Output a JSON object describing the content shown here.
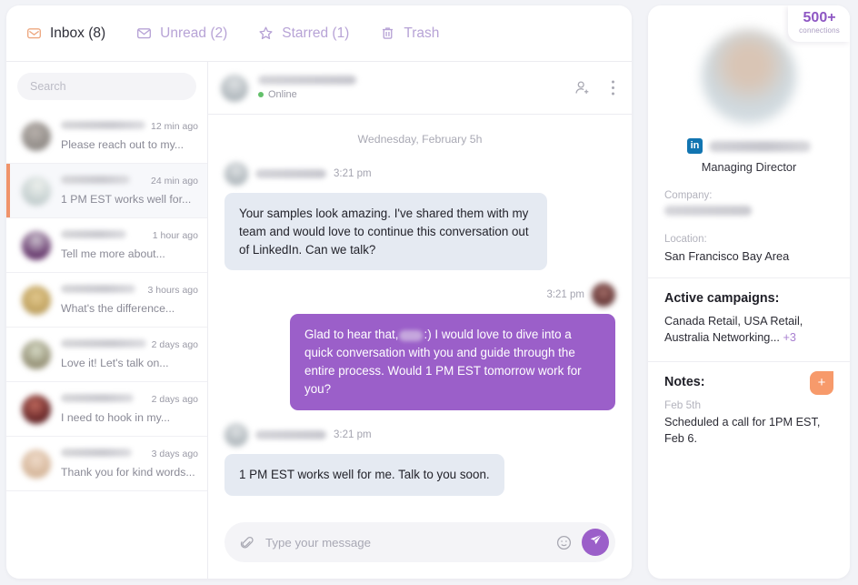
{
  "tabs": [
    {
      "label": "Inbox (8)",
      "icon": "inbox-envelope-icon",
      "active": true
    },
    {
      "label": "Unread (2)",
      "icon": "envelope-icon",
      "active": false
    },
    {
      "label": "Starred (1)",
      "icon": "star-icon",
      "active": false
    },
    {
      "label": "Trash",
      "icon": "trash-icon",
      "active": false
    }
  ],
  "search": {
    "placeholder": "Search",
    "value": ""
  },
  "conversations": [
    {
      "name": "",
      "time": "12 min ago",
      "snippet": "Please reach out to my...",
      "selected": false
    },
    {
      "name": "",
      "time": "24 min ago",
      "snippet": "1 PM EST works well for...",
      "selected": true
    },
    {
      "name": "",
      "time": "1 hour ago",
      "snippet": "Tell me more about...",
      "selected": false
    },
    {
      "name": "",
      "time": "3 hours ago",
      "snippet": "What's the difference...",
      "selected": false
    },
    {
      "name": "",
      "time": "2 days ago",
      "snippet": "Love it! Let's talk on...",
      "selected": false
    },
    {
      "name": "",
      "time": "2 days ago",
      "snippet": "I need to hook in my...",
      "selected": false
    },
    {
      "name": "",
      "time": "3 days ago",
      "snippet": "Thank you for kind words...",
      "selected": false
    }
  ],
  "chat": {
    "header": {
      "name": "",
      "status": "Online",
      "add_person_icon": "add-person-icon",
      "more_icon": "more-vertical-icon"
    },
    "day_separator": "Wednesday, February 5h",
    "messages": [
      {
        "direction": "in",
        "time": "3:21 pm",
        "text": "Your samples look amazing. I've shared them with my team and would love to continue this conversation out of LinkedIn. Can we talk?"
      },
      {
        "direction": "out",
        "time": "3:21 pm",
        "text_before": "Glad to hear that,",
        "text_after": ":) I would love to dive into a quick conversation with you and guide through the entire process. Would 1 PM EST tomorrow work for you?"
      },
      {
        "direction": "in",
        "time": "3:21 pm",
        "text": "1 PM EST works well for me. Talk to you soon."
      }
    ],
    "composer": {
      "placeholder": "Type your message",
      "value": "",
      "attach_icon": "paperclip-icon",
      "emoji_icon": "smiley-icon",
      "send_icon": "send-paper-plane-icon"
    }
  },
  "profile": {
    "connections_count": "500+",
    "connections_label": "connections",
    "linkedin_badge": "in",
    "name": "",
    "role": "Managing Director",
    "company_label": "Company:",
    "company_value": "",
    "location_label": "Location:",
    "location_value": "San Francisco Bay Area",
    "campaigns_title": "Active campaigns:",
    "campaigns_value": "Canada Retail, USA Retail, Australia Networking...",
    "campaigns_more": "+3",
    "notes_title": "Notes:",
    "add_note_label": "+",
    "note_date": "Feb 5th",
    "note_text": "Scheduled a call for 1PM EST, Feb 6."
  },
  "colors": {
    "accent_purple": "#9b5fc9",
    "accent_orange": "#f0936a",
    "inactive_tab": "#b7a3d6",
    "incoming_bubble": "#e5eaf2",
    "page_bg": "#f2f3f7",
    "linkedin_blue": "#1275b1"
  }
}
